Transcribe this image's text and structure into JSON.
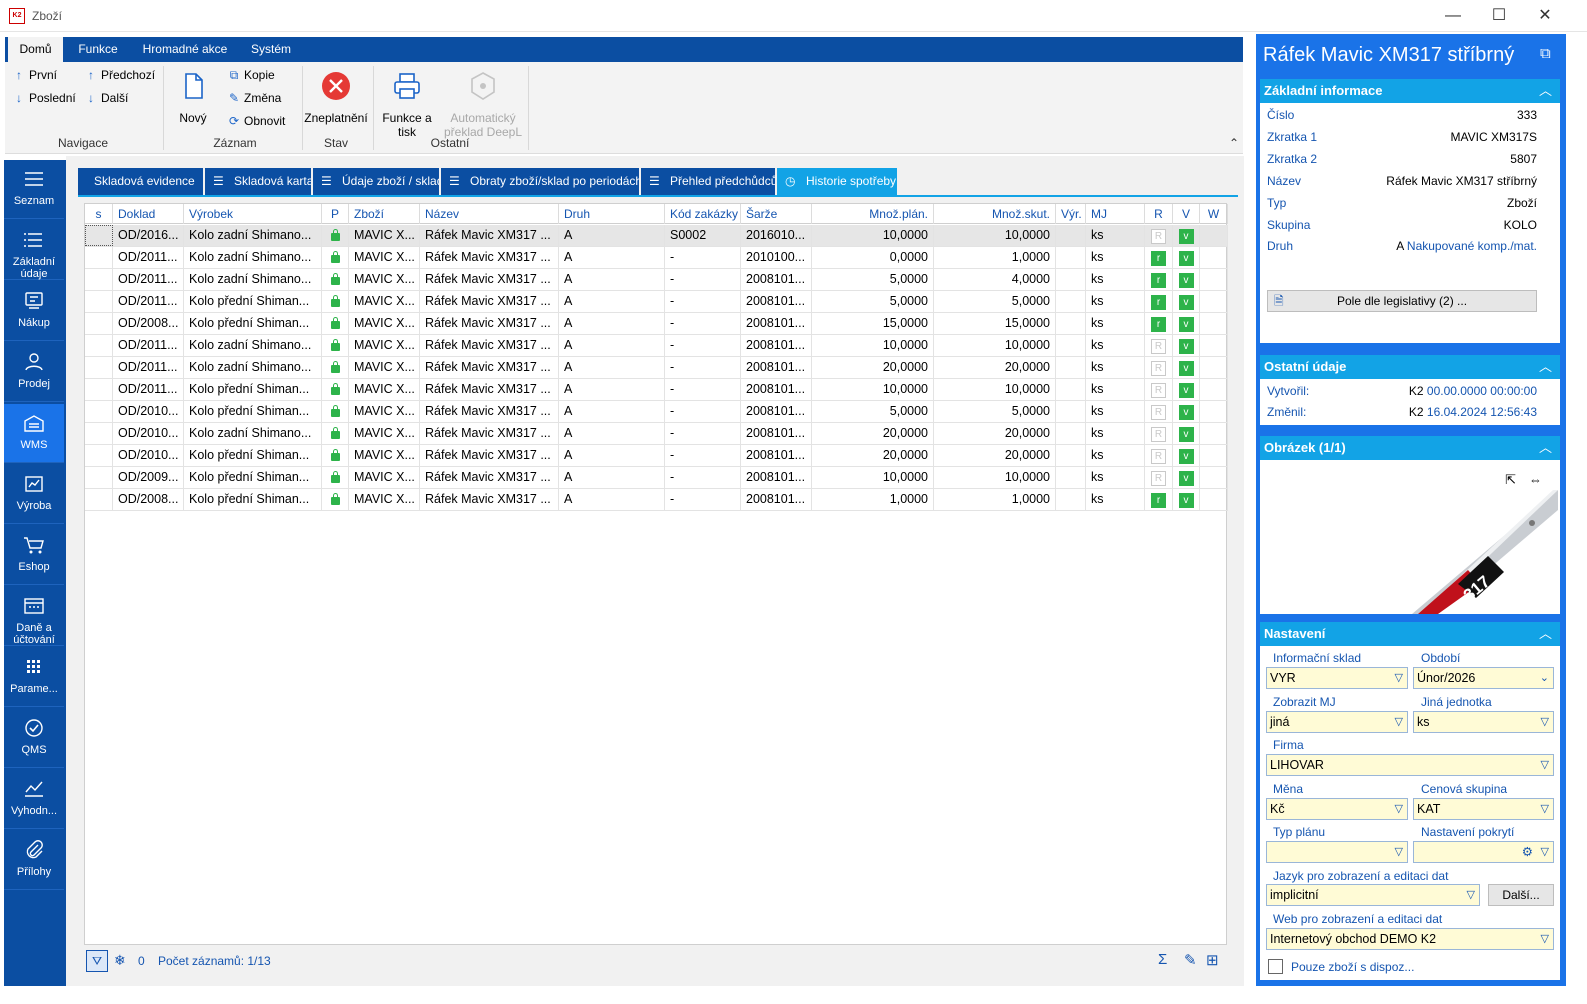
{
  "window": {
    "title": "Zboží",
    "logo_text": "K2",
    "min": "—",
    "max": "☐",
    "close": "✕"
  },
  "ribbon": {
    "tabs": [
      "Domů",
      "Funkce",
      "Hromadné akce",
      "Systém"
    ],
    "nav": {
      "first": "První",
      "last": "Poslední",
      "prev": "Předchozí",
      "next": "Další",
      "label": "Navigace"
    },
    "record": {
      "new": "Nový",
      "copy": "Kopie",
      "change": "Změna",
      "refresh": "Obnovit",
      "label": "Záznam"
    },
    "state": {
      "invalidate": "Zneplatnění",
      "label": "Stav"
    },
    "other": {
      "print_l1": "Funkce a",
      "print_l2": "tisk",
      "deepl_l1": "Automatický",
      "deepl_l2": "překlad DeepL",
      "label": "Ostatní"
    },
    "collapse": "⌃"
  },
  "sidebar": [
    {
      "label": "Seznam",
      "icon": "list-icon"
    },
    {
      "label": "Základní údaje",
      "icon": "list-detail-icon"
    },
    {
      "label": "Nákup",
      "icon": "purchase-icon"
    },
    {
      "label": "Prodej",
      "icon": "sales-icon"
    },
    {
      "label": "WMS",
      "icon": "warehouse-icon"
    },
    {
      "label": "Výroba",
      "icon": "production-icon"
    },
    {
      "label": "Eshop",
      "icon": "cart-icon"
    },
    {
      "label": "Daně a účtování",
      "icon": "accounting-icon"
    },
    {
      "label": "Parame...",
      "icon": "grid-icon"
    },
    {
      "label": "QMS",
      "icon": "check-badge-icon"
    },
    {
      "label": "Vyhodn...",
      "icon": "analytics-icon"
    },
    {
      "label": "Přílohy",
      "icon": "paperclip-icon"
    }
  ],
  "tabs": [
    "Skladová evidence",
    "Skladová karta",
    "Údaje zboží / sklad",
    "Obraty zboží/sklad po periodách",
    "Přehled předchůdců",
    "Historie spotřeby"
  ],
  "grid": {
    "columns": [
      "s",
      "Doklad",
      "Výrobek",
      "P",
      "Zboží",
      "Název",
      "Druh",
      "Kód zakázky",
      "Šarže",
      "Množ.plán.",
      "Množ.skut.",
      "Výr.",
      "MJ",
      "R",
      "V",
      "W"
    ],
    "rows": [
      [
        "OD/2016...",
        "Kolo zadní Shimano...",
        "MAVIC X...",
        "Ráfek Mavic XM317 ...",
        "A",
        "S0002",
        "2016010...",
        "10,0000",
        "10,0000",
        "ks",
        "R",
        "v"
      ],
      [
        "OD/2011...",
        "Kolo zadní Shimano...",
        "MAVIC X...",
        "Ráfek Mavic XM317 ...",
        "A",
        "-",
        "2010100...",
        "0,0000",
        "1,0000",
        "ks",
        "r",
        "v"
      ],
      [
        "OD/2011...",
        "Kolo zadní Shimano...",
        "MAVIC X...",
        "Ráfek Mavic XM317 ...",
        "A",
        "-",
        "2008101...",
        "5,0000",
        "4,0000",
        "ks",
        "r",
        "v"
      ],
      [
        "OD/2011...",
        "Kolo přední Shiman...",
        "MAVIC X...",
        "Ráfek Mavic XM317 ...",
        "A",
        "-",
        "2008101...",
        "5,0000",
        "5,0000",
        "ks",
        "r",
        "v"
      ],
      [
        "OD/2008...",
        "Kolo přední Shiman...",
        "MAVIC X...",
        "Ráfek Mavic XM317 ...",
        "A",
        "-",
        "2008101...",
        "15,0000",
        "15,0000",
        "ks",
        "r",
        "v"
      ],
      [
        "OD/2011...",
        "Kolo zadní Shimano...",
        "MAVIC X...",
        "Ráfek Mavic XM317 ...",
        "A",
        "-",
        "2008101...",
        "10,0000",
        "10,0000",
        "ks",
        "R",
        "v"
      ],
      [
        "OD/2011...",
        "Kolo zadní Shimano...",
        "MAVIC X...",
        "Ráfek Mavic XM317 ...",
        "A",
        "-",
        "2008101...",
        "20,0000",
        "20,0000",
        "ks",
        "R",
        "v"
      ],
      [
        "OD/2011...",
        "Kolo přední Shiman...",
        "MAVIC X...",
        "Ráfek Mavic XM317 ...",
        "A",
        "-",
        "2008101...",
        "10,0000",
        "10,0000",
        "ks",
        "R",
        "v"
      ],
      [
        "OD/2010...",
        "Kolo přední Shiman...",
        "MAVIC X...",
        "Ráfek Mavic XM317 ...",
        "A",
        "-",
        "2008101...",
        "5,0000",
        "5,0000",
        "ks",
        "R",
        "v"
      ],
      [
        "OD/2010...",
        "Kolo zadní Shimano...",
        "MAVIC X...",
        "Ráfek Mavic XM317 ...",
        "A",
        "-",
        "2008101...",
        "20,0000",
        "20,0000",
        "ks",
        "R",
        "v"
      ],
      [
        "OD/2010...",
        "Kolo přední Shiman...",
        "MAVIC X...",
        "Ráfek Mavic XM317 ...",
        "A",
        "-",
        "2008101...",
        "20,0000",
        "20,0000",
        "ks",
        "R",
        "v"
      ],
      [
        "OD/2009...",
        "Kolo přední Shiman...",
        "MAVIC X...",
        "Ráfek Mavic XM317 ...",
        "A",
        "-",
        "2008101...",
        "10,0000",
        "10,0000",
        "ks",
        "R",
        "v"
      ],
      [
        "OD/2008...",
        "Kolo přední Shiman...",
        "MAVIC X...",
        "Ráfek Mavic XM317 ...",
        "A",
        "-",
        "2008101...",
        "1,0000",
        "1,0000",
        "ks",
        "r",
        "v"
      ]
    ]
  },
  "status": {
    "filter_count": "0",
    "record_count": "Počet záznamů: 1/13"
  },
  "panel": {
    "title": "Ráfek Mavic XM317 stříbrný",
    "basic_head": "Základní informace",
    "basic": [
      {
        "k": "Číslo",
        "v": "333"
      },
      {
        "k": "Zkratka 1",
        "v": "MAVIC XM317S"
      },
      {
        "k": "Zkratka 2",
        "v": "5807"
      },
      {
        "k": "Název",
        "v": "Ráfek Mavic XM317 stříbrný"
      },
      {
        "k": "Typ",
        "v": "Zboží"
      },
      {
        "k": "Skupina",
        "v": "KOLO"
      }
    ],
    "druh_label": "Druh",
    "druh_code": "A",
    "druh_link": "Nakupované komp./mat.",
    "legislation_btn": "Pole dle legislativy (2) ...",
    "other_head": "Ostatní údaje",
    "created_label": "Vytvořil:",
    "created_user": "K2",
    "created_date": "00.00.0000 00:00:00",
    "changed_label": "Změnil:",
    "changed_user": "K2",
    "changed_date": "16.04.2024 12:56:43",
    "image_head": "Obrázek (1/1)",
    "image_text": "317",
    "settings_head": "Nastavení",
    "settings": {
      "info_sklad_label": "Informační sklad",
      "info_sklad": "VYR",
      "obdobi_label": "Období",
      "obdobi": "Únor/2026",
      "zobrazit_mj_label": "Zobrazit MJ",
      "zobrazit_mj": "jiná",
      "jina_jednotka_label": "Jiná jednotka",
      "jina_jednotka": "ks",
      "firma_label": "Firma",
      "firma": "LIHOVAR",
      "mena_label": "Měna",
      "mena": "Kč",
      "cenova_skupina_label": "Cenová skupina",
      "cenova_skupina": "KAT",
      "typ_planu_label": "Typ plánu",
      "typ_planu": "",
      "nastaveni_pokryti_label": "Nastavení pokrytí",
      "nastaveni_pokryti": "",
      "jazyk_label": "Jazyk pro zobrazení a editaci dat",
      "jazyk": "implicitní",
      "dalsi_btn": "Další...",
      "web_label": "Web pro zobrazení a editaci dat",
      "web": "Internetový obchod DEMO K2",
      "only_available": "Pouze zboží s dispoz..."
    }
  },
  "colors": {
    "ribbon_blue": "#0b4ea2",
    "accent": "#1a73e8",
    "tab_active": "#12a3e6",
    "green": "#2db34a",
    "field_bg": "#fffbd6"
  }
}
